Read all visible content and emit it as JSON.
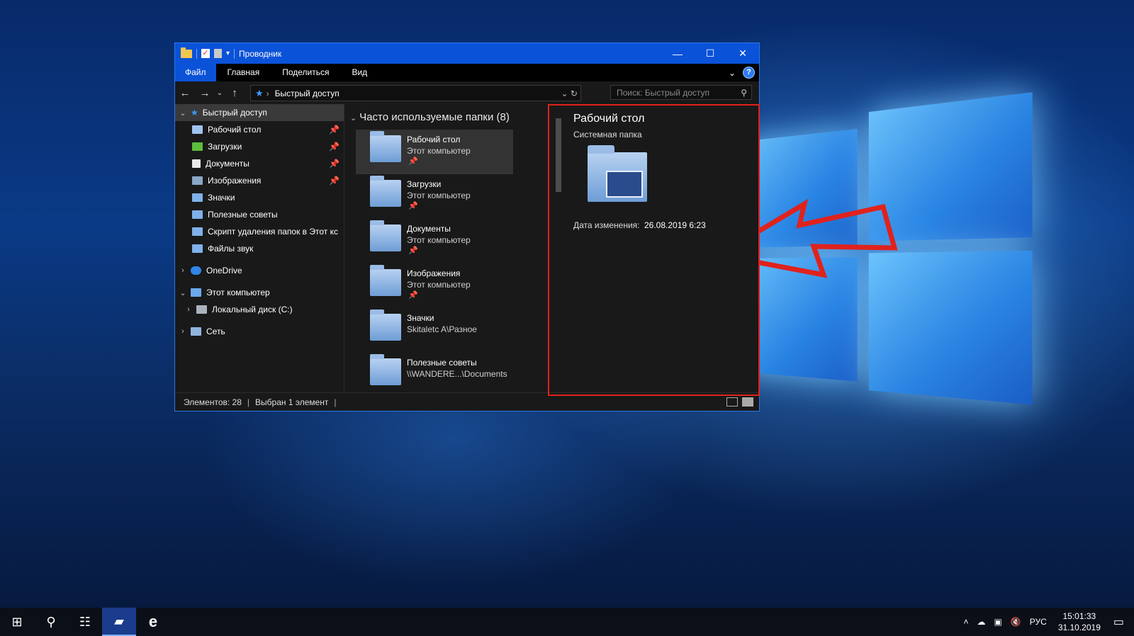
{
  "window": {
    "title": "Проводник",
    "ribbon_tabs": [
      "Файл",
      "Главная",
      "Поделиться",
      "Вид"
    ],
    "address_current": "Быстрый доступ",
    "search_placeholder": "Поиск: Быстрый доступ",
    "controls": {
      "minimize": "—",
      "maximize": "☐",
      "close": "✕"
    }
  },
  "navigation": {
    "quick_access": "Быстрый доступ",
    "pinned": [
      {
        "label": "Рабочий стол",
        "icon": "desktop-icon",
        "pinned": true
      },
      {
        "label": "Загрузки",
        "icon": "downloads-icon",
        "pinned": true
      },
      {
        "label": "Документы",
        "icon": "documents-icon",
        "pinned": true
      },
      {
        "label": "Изображения",
        "icon": "pictures-icon",
        "pinned": true
      },
      {
        "label": "Значки",
        "icon": "folder-icon",
        "pinned": false
      },
      {
        "label": "Полезные советы",
        "icon": "folder-icon",
        "pinned": false
      },
      {
        "label": "Скрипт удаления папок в Этот кс",
        "icon": "folder-icon",
        "pinned": false
      },
      {
        "label": "Файлы звук",
        "icon": "folder-icon",
        "pinned": false
      }
    ],
    "onedrive": "OneDrive",
    "this_pc": "Этот компьютер",
    "local_disk": "Локальный диск (C:)",
    "network": "Сеть"
  },
  "files": {
    "group_header": "Часто используемые папки (8)",
    "items": [
      {
        "name": "Рабочий стол",
        "location": "Этот компьютер",
        "pinned": true
      },
      {
        "name": "Загрузки",
        "location": "Этот компьютер",
        "pinned": true
      },
      {
        "name": "Документы",
        "location": "Этот компьютер",
        "pinned": true
      },
      {
        "name": "Изображения",
        "location": "Этот компьютер",
        "pinned": true
      },
      {
        "name": "Значки",
        "location": "Skitaletc A\\Разное",
        "pinned": false
      },
      {
        "name": "Полезные советы",
        "location": "\\\\WANDERE...\\Documents",
        "pinned": false
      }
    ]
  },
  "details": {
    "title": "Рабочий стол",
    "subtitle": "Системная папка",
    "modified_label": "Дата изменения:",
    "modified_value": "26.08.2019 6:23"
  },
  "status": {
    "count": "Элементов: 28",
    "selected": "Выбран 1 элемент"
  },
  "taskbar": {
    "language": "РУС",
    "time": "15:01:33",
    "date": "31.10.2019"
  },
  "colors": {
    "accent": "#0a52d8",
    "annotation": "#e0221c",
    "pin": "#e6403a"
  }
}
